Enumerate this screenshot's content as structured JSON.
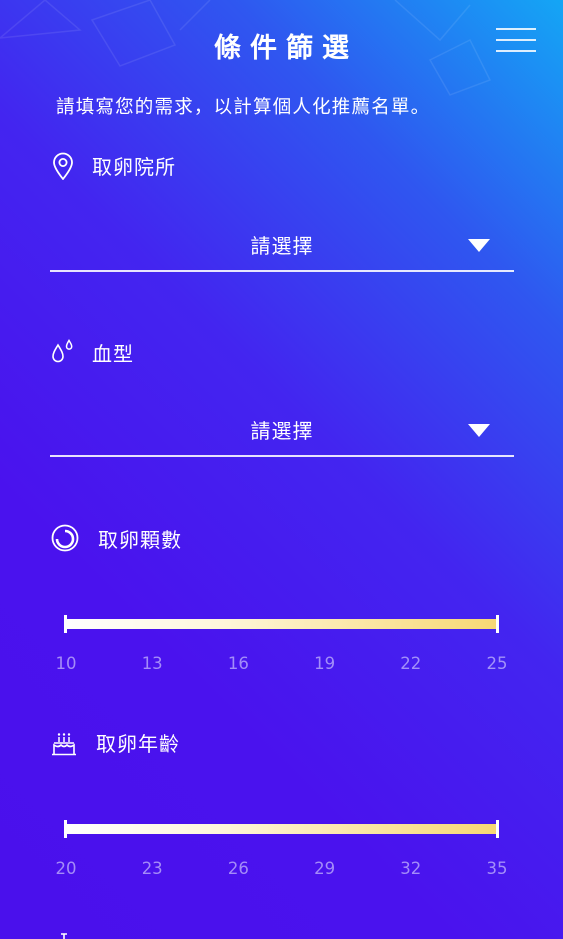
{
  "header": {
    "title": "條件篩選",
    "menu_icon": "hamburger-menu-icon"
  },
  "intro": "請填寫您的需求，以計算個人化推薦名單。",
  "clinic": {
    "label": "取卵院所",
    "icon": "location-pin-icon",
    "value": "請選擇"
  },
  "blood_type": {
    "label": "血型",
    "icon": "water-drops-icon",
    "value": "請選擇"
  },
  "egg_count": {
    "label": "取卵顆數",
    "icon": "egg-circle-icon",
    "min": 10,
    "max": 25,
    "selected_min": 10,
    "selected_max": 25,
    "ticks": [
      "10",
      "13",
      "16",
      "19",
      "22",
      "25"
    ]
  },
  "egg_age": {
    "label": "取卵年齡",
    "icon": "birthday-cake-icon",
    "min": 20,
    "max": 35,
    "selected_min": 20,
    "selected_max": 35,
    "ticks": [
      "20",
      "23",
      "26",
      "29",
      "32",
      "35"
    ]
  },
  "colors": {
    "track_start": "#ffffff",
    "track_end": "#f7d873",
    "background_top_right": "#14a6f5",
    "background_main": "#4a12ee"
  }
}
